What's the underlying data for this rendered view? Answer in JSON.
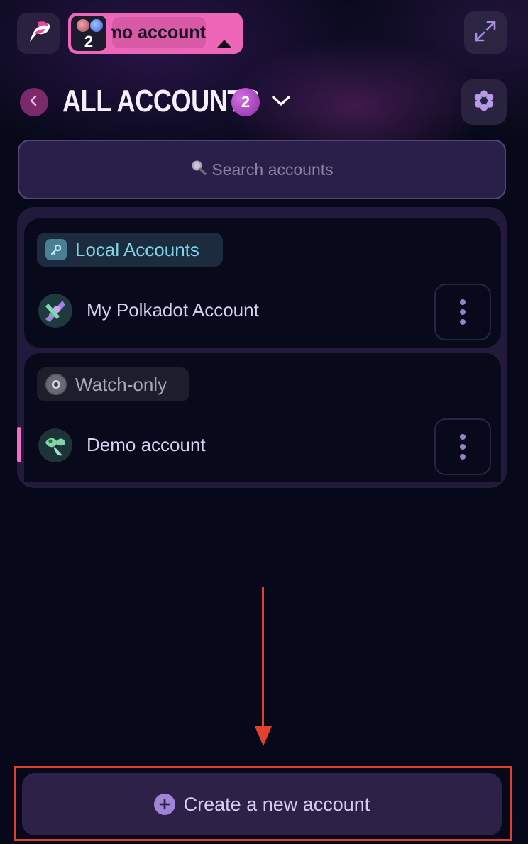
{
  "header": {
    "logo_icon": "polkadot-wallet-logo-icon",
    "selected_account": {
      "name": "Demo account",
      "count": "2",
      "caret_icon": "caret-up-icon"
    },
    "expand_icon": "expand-arrows-icon"
  },
  "title_row": {
    "back_icon": "chevron-left-icon",
    "title": "ALL ACCOUNTS",
    "count": "2",
    "chevron_icon": "chevron-down-icon",
    "settings_icon": "gear-icon"
  },
  "search": {
    "placeholder": "Search accounts",
    "icon": "search-icon"
  },
  "groups": [
    {
      "label": "Local Accounts",
      "icon": "key-icon",
      "accounts": [
        {
          "name": "My Polkadot Account",
          "menu_icon": "more-vertical-icon"
        }
      ]
    },
    {
      "label": "Watch-only",
      "icon": "eye-icon",
      "accounts": [
        {
          "name": "Demo account",
          "menu_icon": "more-vertical-icon",
          "selected": true
        }
      ]
    }
  ],
  "footer": {
    "create_label": "Create a new account",
    "create_icon": "plus-circle-icon"
  },
  "colors": {
    "background": "#07091a",
    "accent_pink": "#ee66b8",
    "local_tag_text": "#7fd3ec",
    "annotation_red": "#e0402c"
  }
}
